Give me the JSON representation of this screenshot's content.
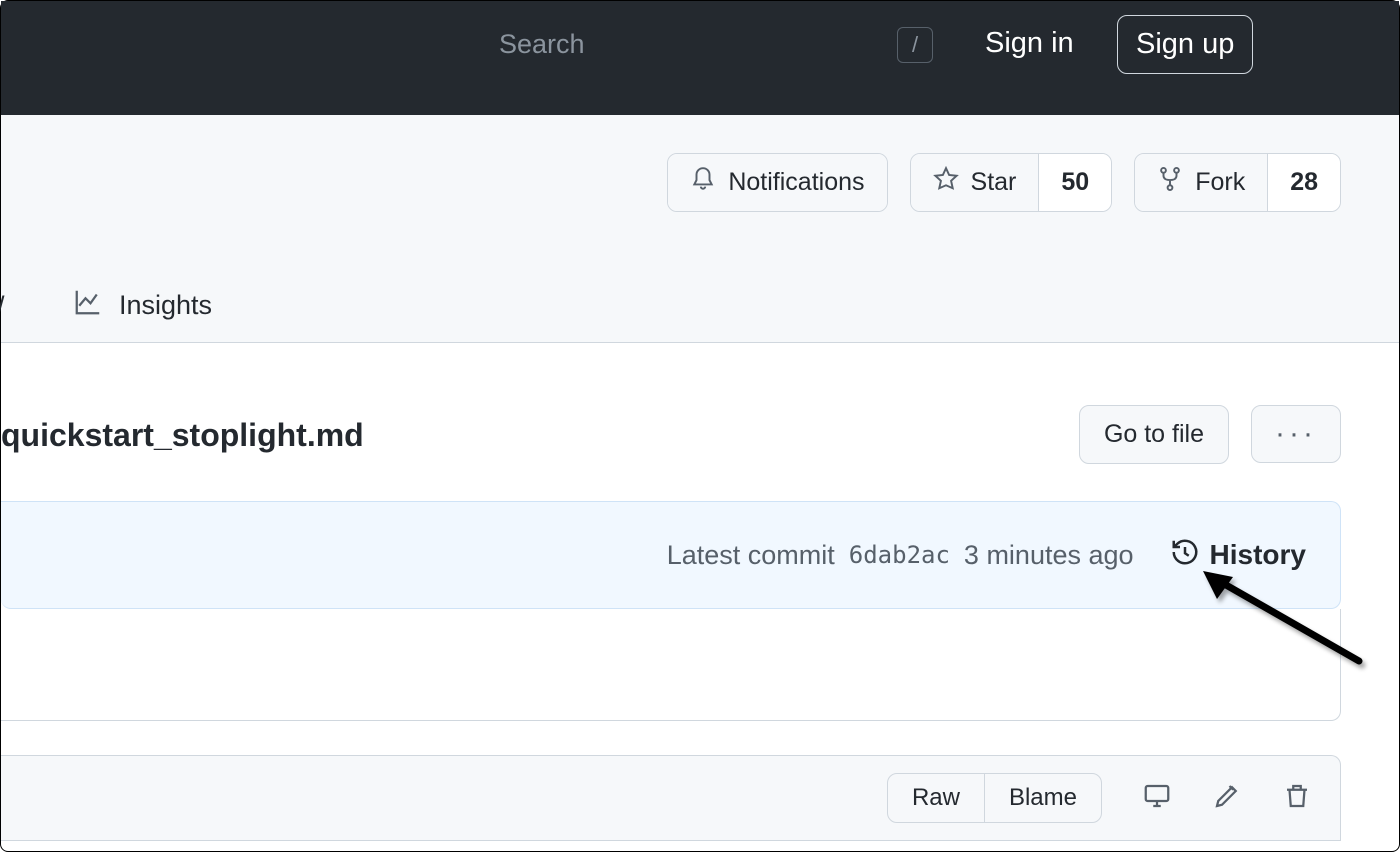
{
  "header": {
    "search_placeholder": "Search",
    "slash": "/",
    "sign_in": "Sign in",
    "sign_up": "Sign up"
  },
  "actions": {
    "notifications": "Notifications",
    "star": "Star",
    "star_count": "50",
    "fork": "Fork",
    "fork_count": "28"
  },
  "tabs": {
    "partial": "/",
    "insights": "Insights"
  },
  "file": {
    "name": "quickstart_stoplight.md",
    "go_to_file": "Go to file"
  },
  "commit": {
    "latest_label": "Latest commit",
    "hash": "6dab2ac",
    "time": "3 minutes ago",
    "history": "History"
  },
  "toolbar": {
    "raw": "Raw",
    "blame": "Blame"
  }
}
